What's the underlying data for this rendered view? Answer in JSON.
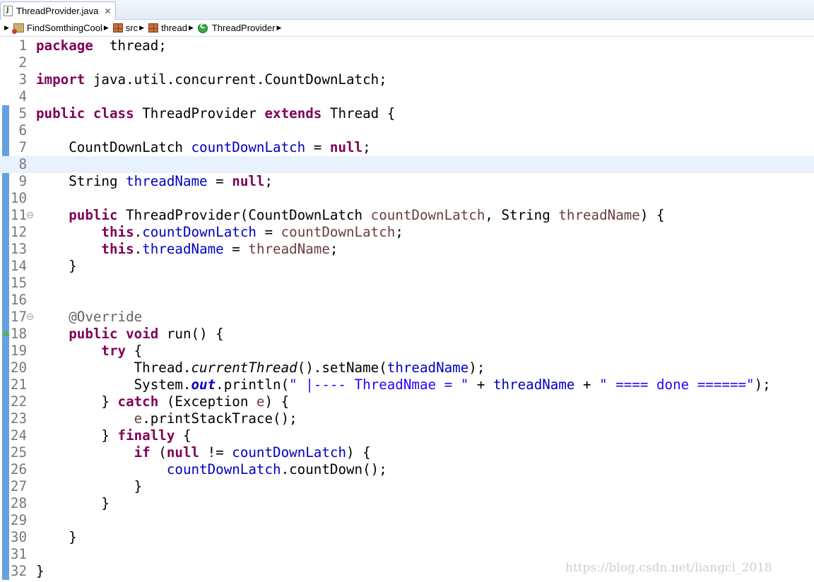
{
  "tab": {
    "label": "ThreadProvider.java",
    "close": "✕"
  },
  "breadcrumb": {
    "project": "FindSomthingCool",
    "folder": "src",
    "package": "thread",
    "class": "ThreadProvider"
  },
  "watermark": "https://blog.csdn.net/liangcl_2018",
  "current_line": 8,
  "lines": [
    {
      "n": "1",
      "t": [
        [
          "kw",
          "package"
        ],
        [
          "",
          "  thread;"
        ]
      ]
    },
    {
      "n": "2",
      "t": []
    },
    {
      "n": "3",
      "t": [
        [
          "kw",
          "import"
        ],
        [
          "",
          " java.util.concurrent.CountDownLatch;"
        ]
      ]
    },
    {
      "n": "4",
      "t": []
    },
    {
      "n": "5",
      "t": [
        [
          "kw",
          "public"
        ],
        [
          "",
          " "
        ],
        [
          "kw",
          "class"
        ],
        [
          "",
          " ThreadProvider "
        ],
        [
          "kw",
          "extends"
        ],
        [
          "",
          " Thread {"
        ]
      ]
    },
    {
      "n": "6",
      "t": []
    },
    {
      "n": "7",
      "t": [
        [
          "",
          "    CountDownLatch "
        ],
        [
          "fld",
          "countDownLatch"
        ],
        [
          "",
          " = "
        ],
        [
          "kw",
          "null"
        ],
        [
          "",
          ";"
        ]
      ]
    },
    {
      "n": "8",
      "t": []
    },
    {
      "n": "9",
      "t": [
        [
          "",
          "    String "
        ],
        [
          "fld",
          "threadName"
        ],
        [
          "",
          " = "
        ],
        [
          "kw",
          "null"
        ],
        [
          "",
          ";"
        ]
      ]
    },
    {
      "n": "10",
      "t": []
    },
    {
      "n": "11",
      "fold": true,
      "t": [
        [
          "",
          "    "
        ],
        [
          "kw",
          "public"
        ],
        [
          "",
          " ThreadProvider(CountDownLatch "
        ],
        [
          "par",
          "countDownLatch"
        ],
        [
          "",
          ", String "
        ],
        [
          "par",
          "threadName"
        ],
        [
          "",
          ") {"
        ]
      ]
    },
    {
      "n": "12",
      "t": [
        [
          "",
          "        "
        ],
        [
          "kw",
          "this"
        ],
        [
          "",
          "."
        ],
        [
          "fld",
          "countDownLatch"
        ],
        [
          "",
          " = "
        ],
        [
          "par",
          "countDownLatch"
        ],
        [
          "",
          ";"
        ]
      ]
    },
    {
      "n": "13",
      "t": [
        [
          "",
          "        "
        ],
        [
          "kw",
          "this"
        ],
        [
          "",
          "."
        ],
        [
          "fld",
          "threadName"
        ],
        [
          "",
          " = "
        ],
        [
          "par",
          "threadName"
        ],
        [
          "",
          ";"
        ]
      ]
    },
    {
      "n": "14",
      "t": [
        [
          "",
          "    }"
        ]
      ]
    },
    {
      "n": "15",
      "t": []
    },
    {
      "n": "16",
      "t": []
    },
    {
      "n": "17",
      "fold": true,
      "t": [
        [
          "",
          "    "
        ],
        [
          "ann",
          "@Override"
        ]
      ]
    },
    {
      "n": "18",
      "override": true,
      "t": [
        [
          "",
          "    "
        ],
        [
          "kw",
          "public"
        ],
        [
          "",
          " "
        ],
        [
          "kw",
          "void"
        ],
        [
          "",
          " run() {"
        ]
      ]
    },
    {
      "n": "19",
      "t": [
        [
          "",
          "        "
        ],
        [
          "kw",
          "try"
        ],
        [
          "",
          " {"
        ]
      ]
    },
    {
      "n": "20",
      "t": [
        [
          "",
          "            Thread."
        ],
        [
          "smi",
          "currentThread"
        ],
        [
          "",
          "().setName("
        ],
        [
          "fld",
          "threadName"
        ],
        [
          "",
          ");"
        ]
      ]
    },
    {
      "n": "21",
      "t": [
        [
          "",
          "            System."
        ],
        [
          "sfi",
          "out"
        ],
        [
          "",
          ".println("
        ],
        [
          "str",
          "\" |---- ThreadNmae = \""
        ],
        [
          "",
          " + "
        ],
        [
          "fld",
          "threadName"
        ],
        [
          "",
          " + "
        ],
        [
          "str",
          "\" ==== done ======\""
        ],
        [
          "",
          ");"
        ]
      ]
    },
    {
      "n": "22",
      "t": [
        [
          "",
          "        } "
        ],
        [
          "kw",
          "catch"
        ],
        [
          "",
          " (Exception "
        ],
        [
          "par",
          "e"
        ],
        [
          "",
          ") {"
        ]
      ]
    },
    {
      "n": "23",
      "t": [
        [
          "",
          "            "
        ],
        [
          "par",
          "e"
        ],
        [
          "",
          ".printStackTrace();"
        ]
      ]
    },
    {
      "n": "24",
      "t": [
        [
          "",
          "        } "
        ],
        [
          "kw",
          "finally"
        ],
        [
          "",
          " {"
        ]
      ]
    },
    {
      "n": "25",
      "t": [
        [
          "",
          "            "
        ],
        [
          "kw",
          "if"
        ],
        [
          "",
          " ("
        ],
        [
          "kw",
          "null"
        ],
        [
          "",
          " != "
        ],
        [
          "fld",
          "countDownLatch"
        ],
        [
          "",
          ") {"
        ]
      ]
    },
    {
      "n": "26",
      "t": [
        [
          "",
          "                "
        ],
        [
          "fld",
          "countDownLatch"
        ],
        [
          "",
          ".countDown();"
        ]
      ]
    },
    {
      "n": "27",
      "t": [
        [
          "",
          "            }"
        ]
      ]
    },
    {
      "n": "28",
      "t": [
        [
          "",
          "        }"
        ]
      ]
    },
    {
      "n": "29",
      "t": []
    },
    {
      "n": "30",
      "t": [
        [
          "",
          "    }"
        ]
      ]
    },
    {
      "n": "31",
      "t": []
    },
    {
      "n": "32",
      "t": [
        [
          "",
          "}"
        ]
      ]
    }
  ]
}
